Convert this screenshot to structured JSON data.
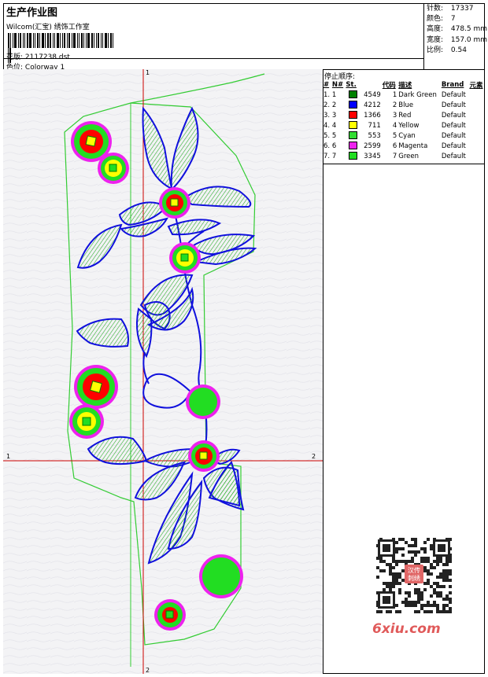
{
  "header": {
    "title": "生产作业图",
    "company": "Wilcom(汇宝) 绣饰工作室",
    "design_label": "花版:",
    "design_value": "2117238.dst",
    "colorway_label": "色位:",
    "colorway_value": "Colorway 1"
  },
  "stats": [
    {
      "label": "针数:",
      "value": "17337"
    },
    {
      "label": "颜色:",
      "value": "7"
    },
    {
      "label": "高度:",
      "value": "478.5 mm"
    },
    {
      "label": "宽度:",
      "value": "157.0 mm"
    },
    {
      "label": "比例:",
      "value": "0.54"
    }
  ],
  "stop_sequence": {
    "title": "停止顺序:",
    "columns": [
      "#",
      "N#",
      "St.",
      "代码",
      "描述",
      "Brand",
      "元素"
    ],
    "rows": [
      {
        "idx": "1.",
        "n": "1",
        "color": "#008000",
        "st": "4549",
        "code": "1",
        "desc": "Dark Green",
        "brand": "Default"
      },
      {
        "idx": "2.",
        "n": "2",
        "color": "#0000ff",
        "st": "4212",
        "code": "2",
        "desc": "Blue",
        "brand": "Default"
      },
      {
        "idx": "3.",
        "n": "3",
        "color": "#ff0000",
        "st": "1366",
        "code": "3",
        "desc": "Red",
        "brand": "Default"
      },
      {
        "idx": "4.",
        "n": "4",
        "color": "#ffff00",
        "st": "711",
        "code": "4",
        "desc": "Yellow",
        "brand": "Default"
      },
      {
        "idx": "5.",
        "n": "5",
        "color": "#33dd33",
        "st": "553",
        "code": "5",
        "desc": "Cyan",
        "brand": "Default"
      },
      {
        "idx": "6.",
        "n": "6",
        "color": "#ee22ee",
        "st": "2599",
        "code": "6",
        "desc": "Magenta",
        "brand": "Default"
      },
      {
        "idx": "7.",
        "n": "7",
        "color": "#22dd22",
        "st": "3345",
        "code": "7",
        "desc": "Green",
        "brand": "Default"
      }
    ]
  },
  "axes": {
    "x_left": "1",
    "x_right": "2",
    "y_top": "1",
    "y_bottom": "2"
  },
  "watermark": "6xiu.com",
  "qr_badge": "汉传\n刺绣",
  "colors": {
    "outline": "#33cc33",
    "stem": "#1010dd",
    "flower_red": "#ff0000",
    "flower_yellow": "#ffff00",
    "magenta": "#ee22ee",
    "green": "#22dd22",
    "dark_green": "#008000",
    "axis": "#cc0000"
  }
}
